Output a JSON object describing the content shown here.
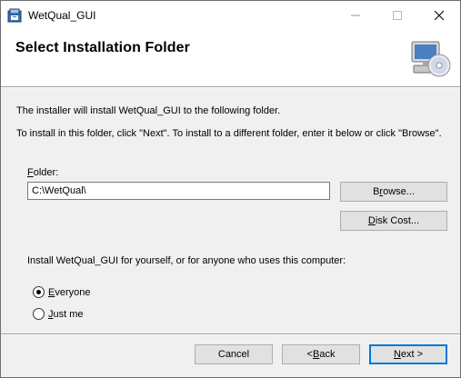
{
  "window": {
    "title": "WetQual_GUI",
    "app_icon": "installer-icon",
    "controls": {
      "minimize_icon": "minimize-icon",
      "maximize_icon": "maximize-icon",
      "close_icon": "close-icon"
    }
  },
  "header": {
    "title": "Select Installation Folder",
    "icon": "computer-cd-icon"
  },
  "body": {
    "line1": "The installer will install WetQual_GUI to the following folder.",
    "line2": "To install in this folder, click \"Next\". To install to a different folder, enter it below or click \"Browse\"."
  },
  "folder": {
    "label_accel": "F",
    "label_rest": "older:",
    "value": "C:\\WetQual\\"
  },
  "buttons": {
    "browse_accel": "r",
    "browse_pre": "B",
    "browse_post": "owse...",
    "diskcost_accel": "D",
    "diskcost_post": "isk Cost...",
    "cancel": "Cancel",
    "back_pre": "< ",
    "back_accel": "B",
    "back_post": "ack",
    "next_accel": "N",
    "next_post": "ext >"
  },
  "install_for": {
    "question": "Install WetQual_GUI for yourself, or for anyone who uses this computer:",
    "options": [
      {
        "accel": "E",
        "rest": "veryone",
        "selected": true
      },
      {
        "accel": "J",
        "rest": "ust me",
        "selected": false
      }
    ]
  },
  "colors": {
    "background": "#f0f0f0",
    "header_bg": "#ffffff",
    "default_button_border": "#0078d7"
  }
}
